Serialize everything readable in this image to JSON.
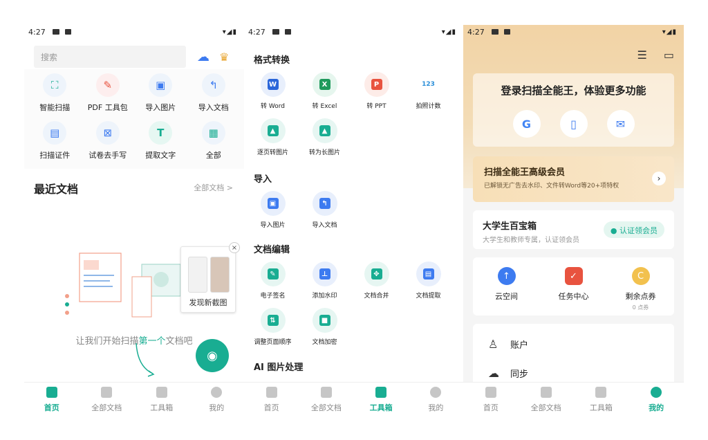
{
  "status": {
    "time": "4:27"
  },
  "nav": {
    "home": "首页",
    "all_docs": "全部文档",
    "toolbox": "工具箱",
    "mine": "我的"
  },
  "home": {
    "search_placeholder": "搜索",
    "tools": [
      "智能扫描",
      "PDF 工具包",
      "导入图片",
      "导入文档",
      "扫描证件",
      "试卷去手写",
      "提取文字",
      "全部"
    ],
    "recent_title": "最近文档",
    "all_docs_link": "全部文档 >",
    "empty_text_pre": "让我们开始扫描",
    "empty_text_hl": "第一个",
    "empty_text_post": "文档吧",
    "popup_caption": "发现新截图",
    "popup_close": "×"
  },
  "toolbox": {
    "sections": [
      {
        "title": "格式转换",
        "items": [
          "转 Word",
          "转 Excel",
          "转 PPT",
          "拍照计数",
          "逐页转图片",
          "转为长图片"
        ]
      },
      {
        "title": "导入",
        "items": [
          "导入图片",
          "导入文档"
        ]
      },
      {
        "title": "文档编辑",
        "items": [
          "电子签名",
          "添加水印",
          "文档合并",
          "文档提取",
          "调整页面顺序",
          "文档加密"
        ]
      },
      {
        "title": "AI 图片处理",
        "items": []
      }
    ],
    "icon_glyphs": [
      "W",
      "X",
      "P",
      "123"
    ]
  },
  "mine": {
    "login_title": "登录扫描全能王，体验更多功能",
    "login_icons": [
      "G",
      "▯",
      "✉"
    ],
    "vip_title": "扫描全能王高级会员",
    "vip_sub": "已解锁无广告去水印、文件转Word等20+项特权",
    "student_title": "大学生百宝箱",
    "student_sub": "大学生和教师专属，认证领会员",
    "student_badge": "认证领会员",
    "services": [
      {
        "label": "云空间",
        "sub": ""
      },
      {
        "label": "任务中心",
        "sub": ""
      },
      {
        "label": "剩余点券",
        "sub": "0 点券"
      }
    ],
    "menu": [
      "账户",
      "同步"
    ]
  }
}
